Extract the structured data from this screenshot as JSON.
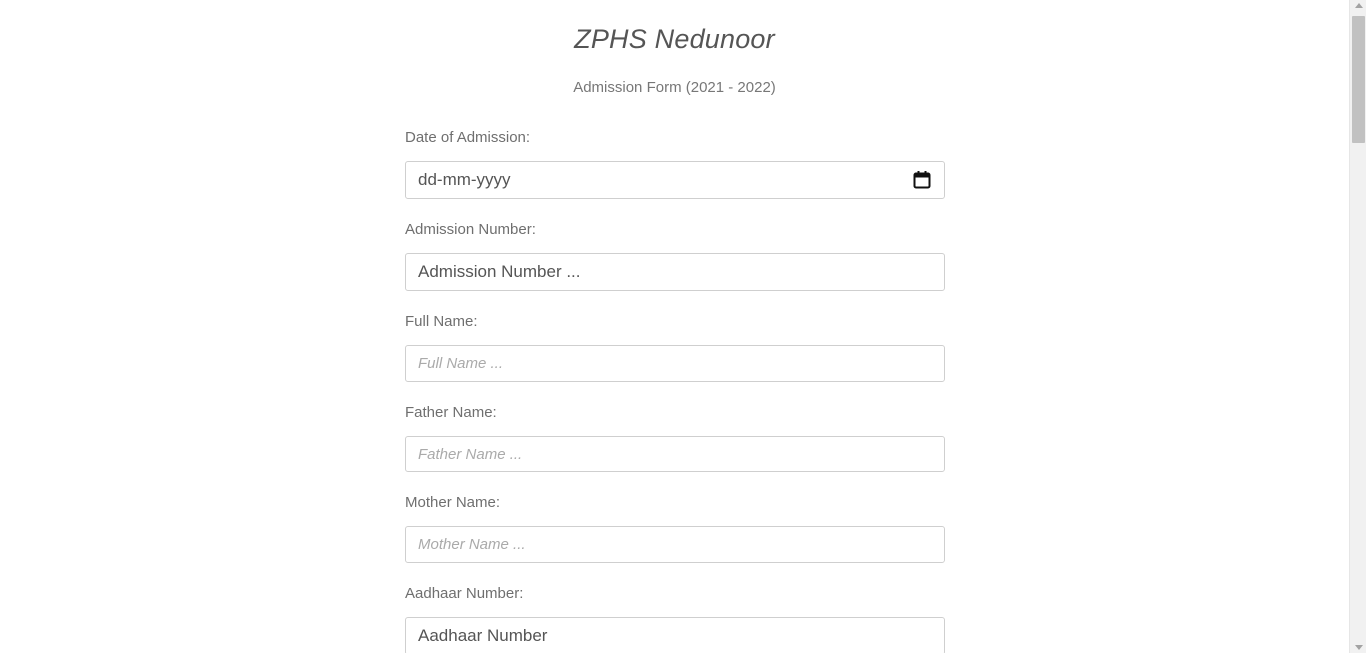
{
  "header": {
    "school_name": "ZPHS Nedunoor",
    "form_title": "Admission Form (2021 - 2022)"
  },
  "form": {
    "date_of_admission": {
      "label": "Date of Admission:",
      "value_display": "dd-mm-yyyy",
      "icon": "calendar-icon"
    },
    "admission_number": {
      "label": "Admission Number:",
      "placeholder": "Admission Number ..."
    },
    "full_name": {
      "label": "Full Name:",
      "placeholder": "Full Name ..."
    },
    "father_name": {
      "label": "Father Name:",
      "placeholder": "Father Name ..."
    },
    "mother_name": {
      "label": "Mother Name:",
      "placeholder": "Mother Name ..."
    },
    "aadhaar_number": {
      "label": "Aadhaar Number:",
      "placeholder": "Aadhaar Number"
    }
  }
}
